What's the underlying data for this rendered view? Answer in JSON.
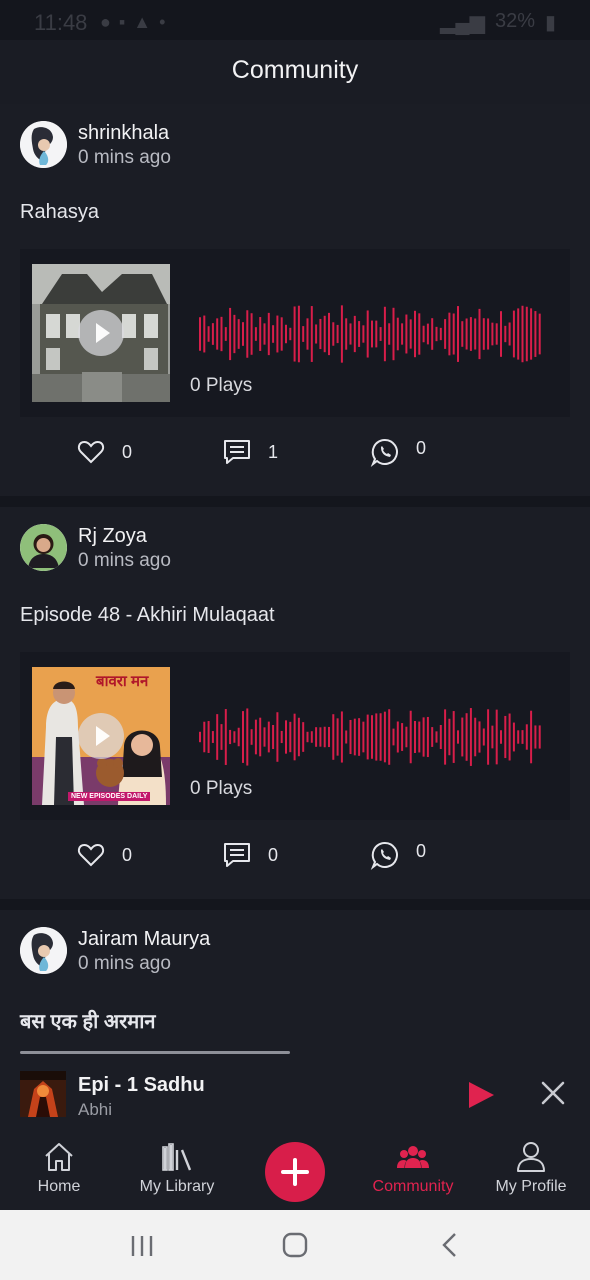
{
  "status_bar": {
    "time": "11:48",
    "battery": "32%"
  },
  "header": {
    "title": "Community"
  },
  "posts": [
    {
      "author": "shrinkhala",
      "time": "0 mins ago",
      "title": "Rahasya",
      "plays": "0 Plays",
      "likes": "0",
      "comments": "1",
      "shares": "0"
    },
    {
      "author": "Rj Zoya",
      "time": "0 mins ago",
      "title": "Episode 48 - Akhiri Mulaqaat",
      "plays": "0 Plays",
      "likes": "0",
      "comments": "0",
      "shares": "0",
      "cover_text": "बावरा मन",
      "cover_badge": "NEW EPISODES DAILY"
    },
    {
      "author": "Jairam Maurya",
      "time": "0 mins ago",
      "title": "बस एक ही अरमान"
    }
  ],
  "mini_player": {
    "title": "Epi - 1 Sadhu",
    "artist": "Abhi"
  },
  "nav": {
    "items": [
      {
        "label": "Home",
        "icon": "home-icon"
      },
      {
        "label": "My Library",
        "icon": "library-icon"
      },
      {
        "label": "Community",
        "icon": "community-icon"
      },
      {
        "label": "My Profile",
        "icon": "profile-icon"
      }
    ],
    "active": "Community"
  },
  "colors": {
    "accent": "#e0234f",
    "background": "#14161d",
    "card": "#1b1d25",
    "waveform": "#d81e4a"
  }
}
